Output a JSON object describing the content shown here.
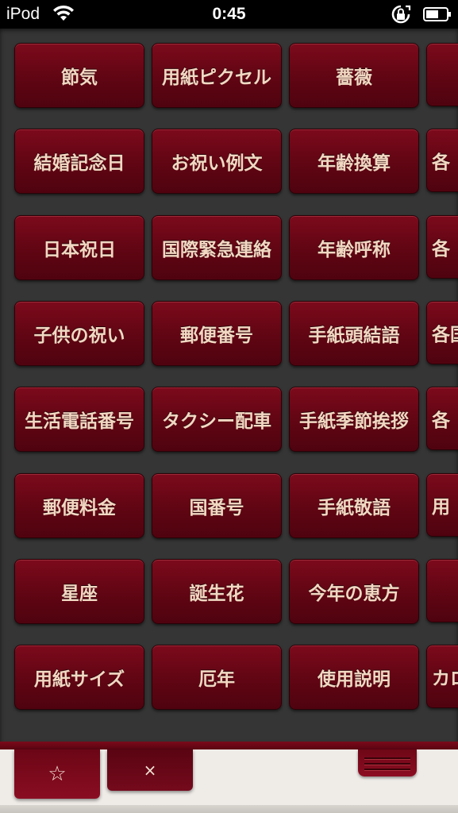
{
  "status_bar": {
    "carrier": "iPod",
    "time": "0:45"
  },
  "grid": {
    "rows": [
      [
        "節気",
        "用紙ピクセル",
        "薔薇",
        ""
      ],
      [
        "結婚記念日",
        "お祝い例文",
        "年齢換算",
        "各"
      ],
      [
        "日本祝日",
        "国際緊急連絡",
        "年齢呼称",
        "各"
      ],
      [
        "子供の祝い",
        "郵便番号",
        "手紙頭結語",
        "各国"
      ],
      [
        "生活電話番号",
        "タクシー配車",
        "手紙季節挨拶",
        "各"
      ],
      [
        "郵便料金",
        "国番号",
        "手紙敬語",
        "用"
      ],
      [
        "星座",
        "誕生花",
        "今年の恵方",
        ""
      ],
      [
        "用紙サイズ",
        "厄年",
        "使用説明",
        "カロ"
      ]
    ]
  },
  "bottom_bar": {
    "favorite_label": "☆",
    "close_label": "×"
  },
  "colors": {
    "button": "#6b0616",
    "button_text": "#f1d8c2",
    "panel": "#353535",
    "bottom": "#efece8"
  }
}
